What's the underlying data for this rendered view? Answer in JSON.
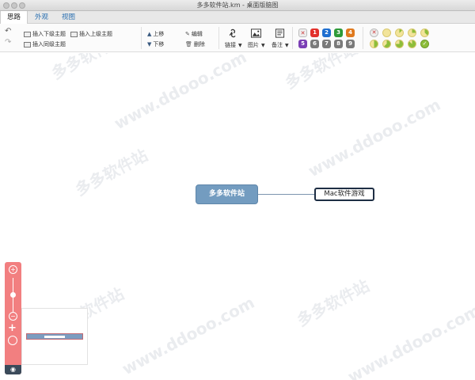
{
  "window": {
    "title": "多多软件站.km - 桌面版脑图"
  },
  "tabs": [
    {
      "label": "思路",
      "active": true
    },
    {
      "label": "外观",
      "active": false
    },
    {
      "label": "视图",
      "active": false
    }
  ],
  "toolbar": {
    "insert_child": "插入下级主题",
    "insert_parent": "插入上级主题",
    "insert_sibling": "插入同级主题",
    "move_up": "上移",
    "move_down": "下移",
    "edit": "编辑",
    "delete": "删除",
    "link": "链接",
    "image": "图片",
    "note": "备注",
    "priorities": [
      {
        "label": "1",
        "color": "#e2302b"
      },
      {
        "label": "2",
        "color": "#1f6fd0"
      },
      {
        "label": "3",
        "color": "#2e9a38"
      },
      {
        "label": "4",
        "color": "#e07a1f"
      },
      {
        "label": "5",
        "color": "#7b3fb5"
      },
      {
        "label": "6",
        "color": "#7a7a7a"
      },
      {
        "label": "7",
        "color": "#7a7a7a"
      },
      {
        "label": "8",
        "color": "#7a7a7a"
      },
      {
        "label": "9",
        "color": "#7a7a7a"
      }
    ],
    "progress_colors": {
      "fill": "#8dbd3a",
      "empty": "#f2e49a"
    }
  },
  "mindmap": {
    "root": "多多软件站",
    "child": "Mac软件游戏"
  },
  "watermark": {
    "cn": "多多软件站",
    "url": "www.ddooo.com"
  },
  "zoom": {
    "in": "+",
    "out": "−"
  }
}
